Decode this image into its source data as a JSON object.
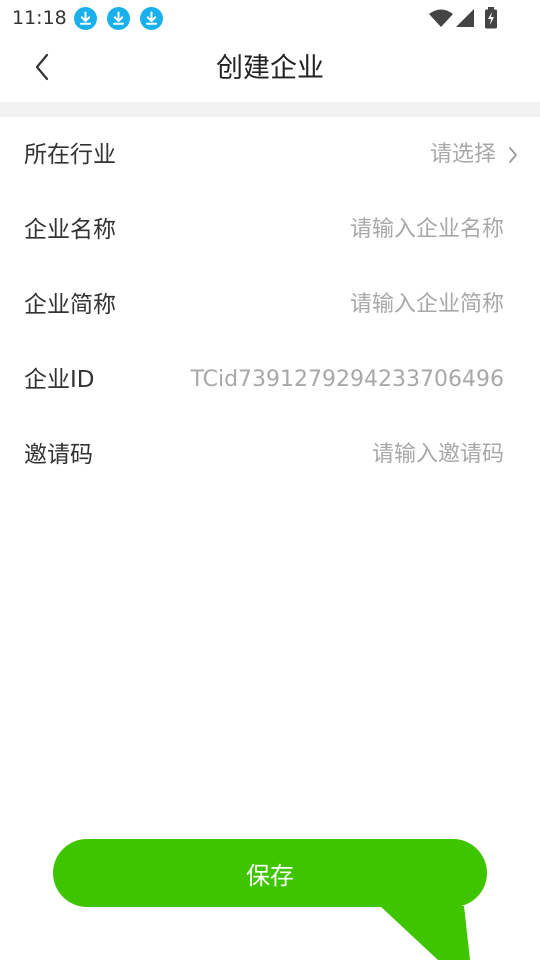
{
  "status_bar": {
    "time": "11:18",
    "notification_icons": [
      "download-icon",
      "download-icon",
      "download-icon"
    ],
    "system_icons": [
      "wifi-icon",
      "signal-icon",
      "battery-charging-icon"
    ],
    "accent_color": "#1ab0ec"
  },
  "nav": {
    "title": "创建企业",
    "back_icon": "chevron-left-icon"
  },
  "form": {
    "industry": {
      "label": "所在行业",
      "value": "请选择",
      "icon": "chevron-right-icon"
    },
    "company_name": {
      "label": "企业名称",
      "placeholder": "请输入企业名称"
    },
    "company_short_name": {
      "label": "企业简称",
      "placeholder": "请输入企业简称"
    },
    "company_id": {
      "label": "企业ID",
      "value": "TCid7391279294233706496"
    },
    "invite_code": {
      "label": "邀请码",
      "placeholder": "请输入邀请码"
    }
  },
  "save_button": {
    "label": "保存",
    "color": "#3fc500"
  }
}
